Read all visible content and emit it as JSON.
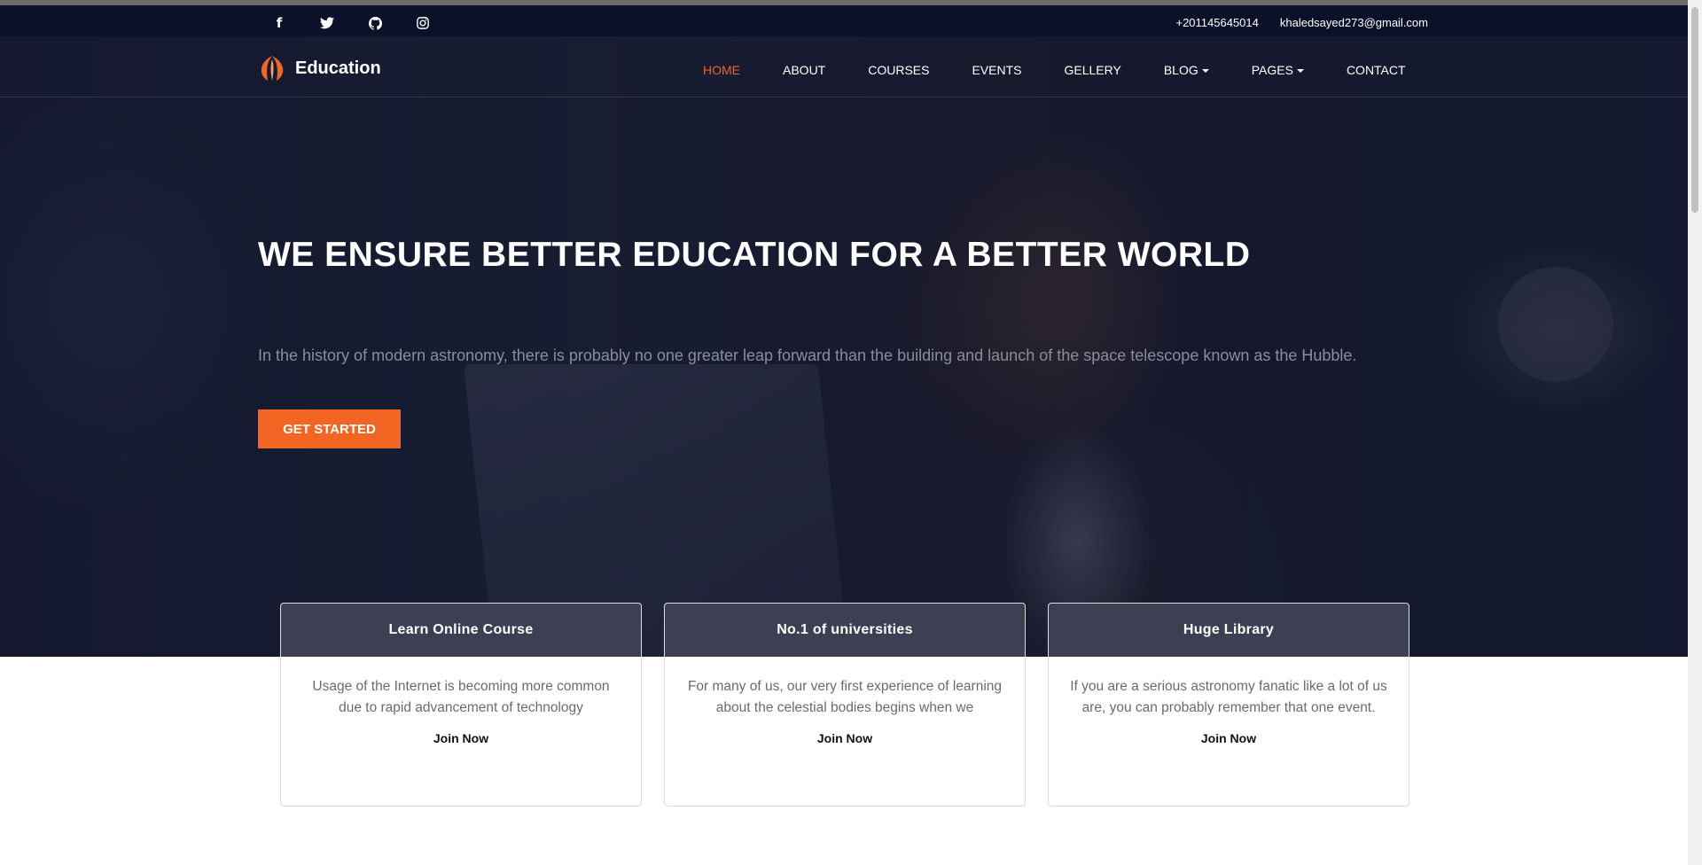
{
  "topbar": {
    "social": [
      {
        "icon": "facebook-icon",
        "glyph": "f"
      },
      {
        "icon": "twitter-icon",
        "glyph": "🐦"
      },
      {
        "icon": "github-icon",
        "glyph": "⌬"
      },
      {
        "icon": "instagram-icon",
        "glyph": "◎"
      }
    ],
    "phone": "+201145645014",
    "email": "khaledsayed273@gmail.com"
  },
  "brand": {
    "name": "Education"
  },
  "nav": {
    "home": "HOME",
    "about": "ABOUT",
    "courses": "COURSES",
    "events": "EVENTS",
    "gellery": "GELLERY",
    "blog": "BLOG",
    "pages": "PAGES",
    "contact": "CONTACT"
  },
  "hero": {
    "title": "WE ENSURE BETTER EDUCATION FOR A BETTER WORLD",
    "lead": "In the history of modern astronomy, there is probably no one greater leap forward than the building and launch of the space telescope known as the Hubble.",
    "cta": "GET STARTED"
  },
  "cards": [
    {
      "title": "Learn Online Course",
      "text": "Usage of the Internet is becoming more common due to rapid advancement of technology",
      "link": "Join Now"
    },
    {
      "title": "No.1 of universities",
      "text": "For many of us, our very first experience of learning about the celestial bodies begins when we",
      "link": "Join Now"
    },
    {
      "title": "Huge Library",
      "text": "If you are a serious astronomy fanatic like a lot of us are, you can probably remember that one event.",
      "link": "Join Now"
    }
  ],
  "colors": {
    "accent": "#f26522",
    "topbar": "#0b1129"
  }
}
